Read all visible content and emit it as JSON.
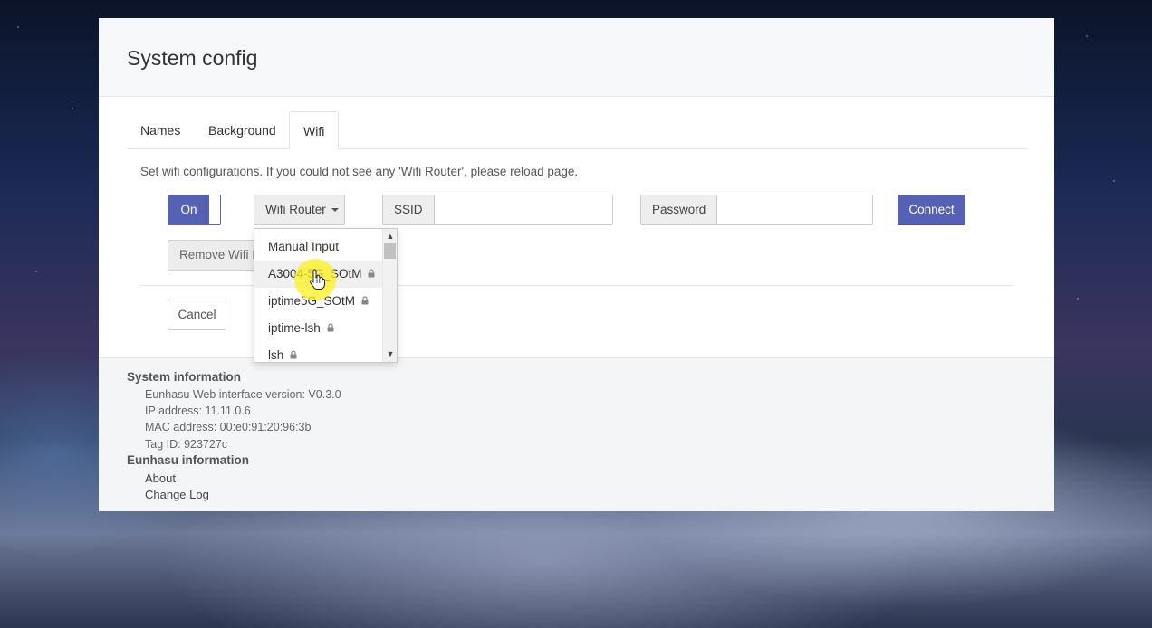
{
  "modal": {
    "title": "System config"
  },
  "tabs": [
    {
      "label": "Names"
    },
    {
      "label": "Background"
    },
    {
      "label": "Wifi"
    }
  ],
  "wifi": {
    "description": "Set wifi configurations. If you could not see any 'Wifi Router', please reload page.",
    "toggle_label": "On",
    "router_button_label": "Wifi Router",
    "ssid_label": "SSID",
    "ssid_value": "",
    "password_label": "Password",
    "password_value": "",
    "connect_label": "Connect",
    "remove_label": "Remove Wifi In",
    "cancel_label": "Cancel",
    "dropdown_items": [
      {
        "label": "Manual Input",
        "locked": false
      },
      {
        "label": "A3004-5G_SOtM",
        "locked": true
      },
      {
        "label": "iptime5G_SOtM",
        "locked": true
      },
      {
        "label": "iptime-lsh",
        "locked": true
      },
      {
        "label": "lsh",
        "locked": true
      }
    ]
  },
  "footer": {
    "system_heading": "System information",
    "version": "Eunhasu Web interface version: V0.3.0",
    "ip": "IP address: 11.11.0.6",
    "mac": "MAC address: 00:e0:91:20:96:3b",
    "tag": "Tag ID: 923727c",
    "eunhasu_heading": "Eunhasu information",
    "about": "About",
    "changelog": "Change Log"
  },
  "colors": {
    "accent": "#5661b3",
    "footer_bg": "#f3f5f6"
  },
  "icons": {
    "lock": "lock-icon",
    "caret": "caret-down-icon",
    "cursor": "hand-pointer-icon"
  }
}
